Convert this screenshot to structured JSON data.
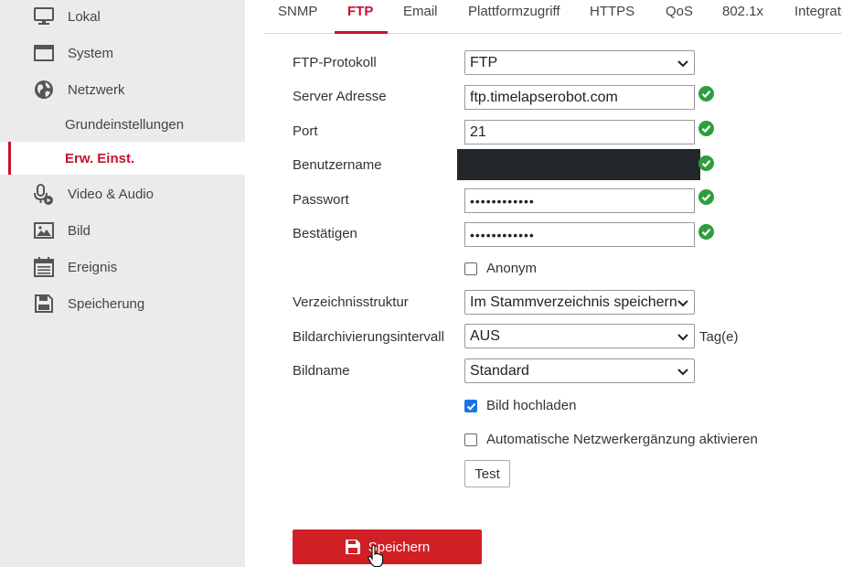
{
  "sidebar": {
    "items": [
      {
        "label": "Lokal",
        "icon": "monitor-icon"
      },
      {
        "label": "System",
        "icon": "window-icon"
      },
      {
        "label": "Netzwerk",
        "icon": "globe-icon"
      },
      {
        "label": "Video & Audio",
        "icon": "microphone-camera-icon"
      },
      {
        "label": "Bild",
        "icon": "image-icon"
      },
      {
        "label": "Ereignis",
        "icon": "calendar-icon"
      },
      {
        "label": "Speicherung",
        "icon": "floppy-disk-icon"
      }
    ],
    "sub_items": [
      {
        "label": "Grundeinstellungen",
        "active": false
      },
      {
        "label": "Erw. Einst.",
        "active": true
      }
    ]
  },
  "tabs": [
    {
      "label": "SNMP"
    },
    {
      "label": "FTP",
      "active": true
    },
    {
      "label": "Email"
    },
    {
      "label": "Plattformzugriff"
    },
    {
      "label": "HTTPS"
    },
    {
      "label": "QoS"
    },
    {
      "label": "802.1x"
    },
    {
      "label": "Integrati"
    }
  ],
  "form": {
    "protocol": {
      "label": "FTP-Protokoll",
      "value": "FTP"
    },
    "server": {
      "label": "Server Adresse",
      "value": "ftp.timelapserobot.com"
    },
    "port": {
      "label": "Port",
      "value": "21"
    },
    "username": {
      "label": "Benutzername"
    },
    "password": {
      "label": "Passwort",
      "value": "••••••••••••"
    },
    "confirm": {
      "label": "Bestätigen",
      "value": "••••••••••••"
    },
    "anonym": {
      "label": "Anonym",
      "checked": false
    },
    "directory": {
      "label": "Verzeichnisstruktur",
      "value": "Im Stammverzeichnis speichern"
    },
    "archive_interval": {
      "label": "Bildarchivierungsintervall",
      "value": "AUS",
      "unit": "Tag(e)"
    },
    "image_name": {
      "label": "Bildname",
      "value": "Standard"
    },
    "upload_image": {
      "label": "Bild hochladen",
      "checked": true
    },
    "auto_network": {
      "label": "Automatische Netzwerkergänzung aktivieren",
      "checked": false
    },
    "test_button": "Test",
    "save_button": "Speichern"
  },
  "colors": {
    "accent": "#c8102e",
    "ok_green": "#2e9e3c",
    "checkbox_blue": "#1a73e8",
    "save_red": "#d01f25"
  }
}
